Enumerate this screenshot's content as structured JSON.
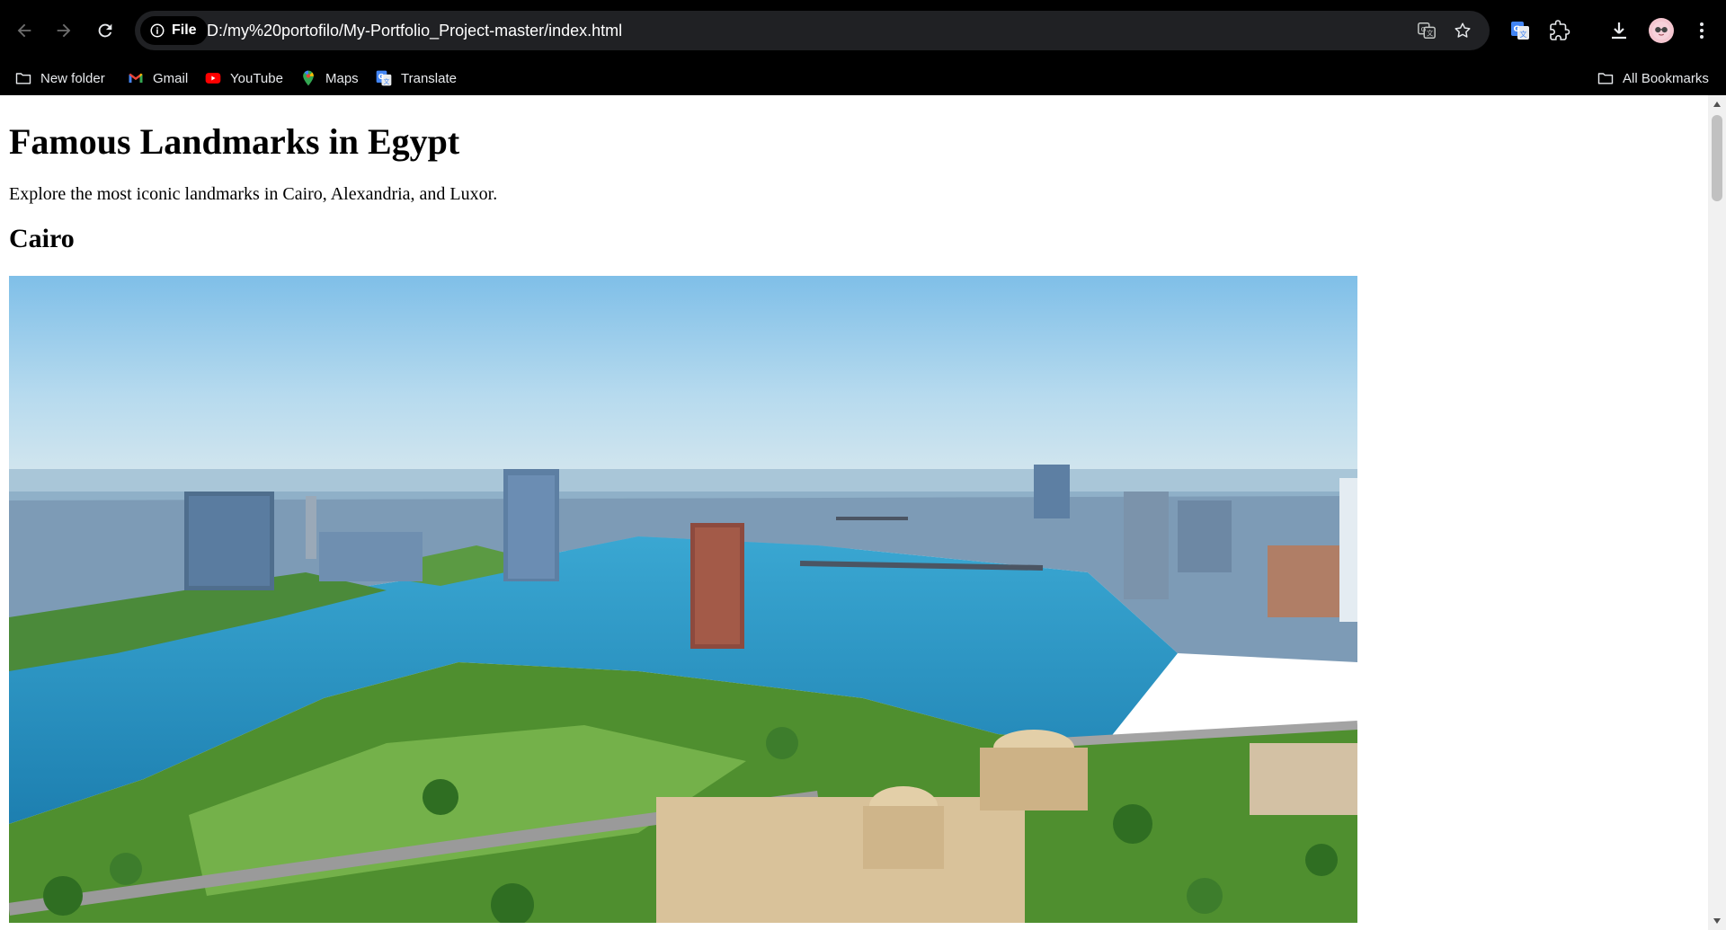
{
  "browser": {
    "chip_label": "File",
    "url": "D:/my%20portofilo/My-Portfolio_Project-master/index.html",
    "bookmarks": [
      {
        "label": "New folder",
        "icon": "folder-icon"
      },
      {
        "label": "Gmail",
        "icon": "gmail-icon"
      },
      {
        "label": "YouTube",
        "icon": "youtube-icon"
      },
      {
        "label": "Maps",
        "icon": "maps-icon"
      },
      {
        "label": "Translate",
        "icon": "translate-icon"
      }
    ],
    "all_bookmarks_label": "All Bookmarks"
  },
  "page": {
    "title": "Famous Landmarks in Egypt",
    "intro": "Explore the most iconic landmarks in Cairo, Alexandria, and Luxor.",
    "sections": [
      {
        "heading": "Cairo",
        "image_alt": "Aerial view of Cairo and the Nile"
      }
    ]
  },
  "colors": {
    "chrome_bg": "#000000",
    "omnibox_bg": "#202124",
    "sky": "#8fc4e6",
    "river": "#2a8fbf",
    "greenery": "#4f8f2f",
    "buildings": "#6f8fb0",
    "sandstone": "#d9c29a"
  }
}
